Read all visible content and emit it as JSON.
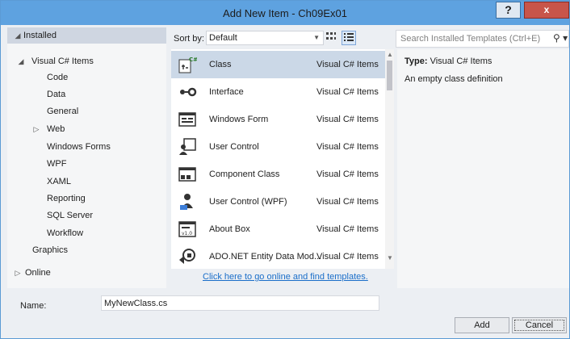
{
  "window": {
    "title": "Add New Item - Ch09Ex01",
    "help_label": "?",
    "close_label": "x"
  },
  "tree": {
    "installed": "Installed",
    "visual_cs": "Visual C# Items",
    "children": [
      "Code",
      "Data",
      "General",
      "Web",
      "Windows Forms",
      "WPF",
      "XAML",
      "Reporting",
      "SQL Server",
      "Workflow"
    ],
    "graphics": "Graphics",
    "online": "Online"
  },
  "toolbar": {
    "sort_label": "Sort by:",
    "sort_value": "Default"
  },
  "search": {
    "placeholder": "Search Installed Templates (Ctrl+E)"
  },
  "items": [
    {
      "name": "Class",
      "type": "Visual C# Items",
      "icon": "class-icon"
    },
    {
      "name": "Interface",
      "type": "Visual C# Items",
      "icon": "interface-icon"
    },
    {
      "name": "Windows Form",
      "type": "Visual C# Items",
      "icon": "windows-form-icon"
    },
    {
      "name": "User Control",
      "type": "Visual C# Items",
      "icon": "user-control-icon"
    },
    {
      "name": "Component Class",
      "type": "Visual C# Items",
      "icon": "component-class-icon"
    },
    {
      "name": "User Control (WPF)",
      "type": "Visual C# Items",
      "icon": "user-control-wpf-icon"
    },
    {
      "name": "About Box",
      "type": "Visual C# Items",
      "icon": "about-box-icon"
    },
    {
      "name": "ADO.NET Entity Data Mod...",
      "type": "Visual C# Items",
      "icon": "entity-data-model-icon"
    }
  ],
  "online_link": "Click here to go online and find templates.",
  "details": {
    "type_label": "Type:",
    "type_value": "Visual C# Items",
    "description": "An empty class definition"
  },
  "bottom": {
    "name_label": "Name:",
    "name_value": "MyNewClass.cs",
    "add_label": "Add",
    "cancel_label": "Cancel"
  },
  "colors": {
    "titlebar": "#5ea2e0",
    "selection": "#cbd8e7",
    "link": "#1a6ec9",
    "close": "#c8554a"
  }
}
